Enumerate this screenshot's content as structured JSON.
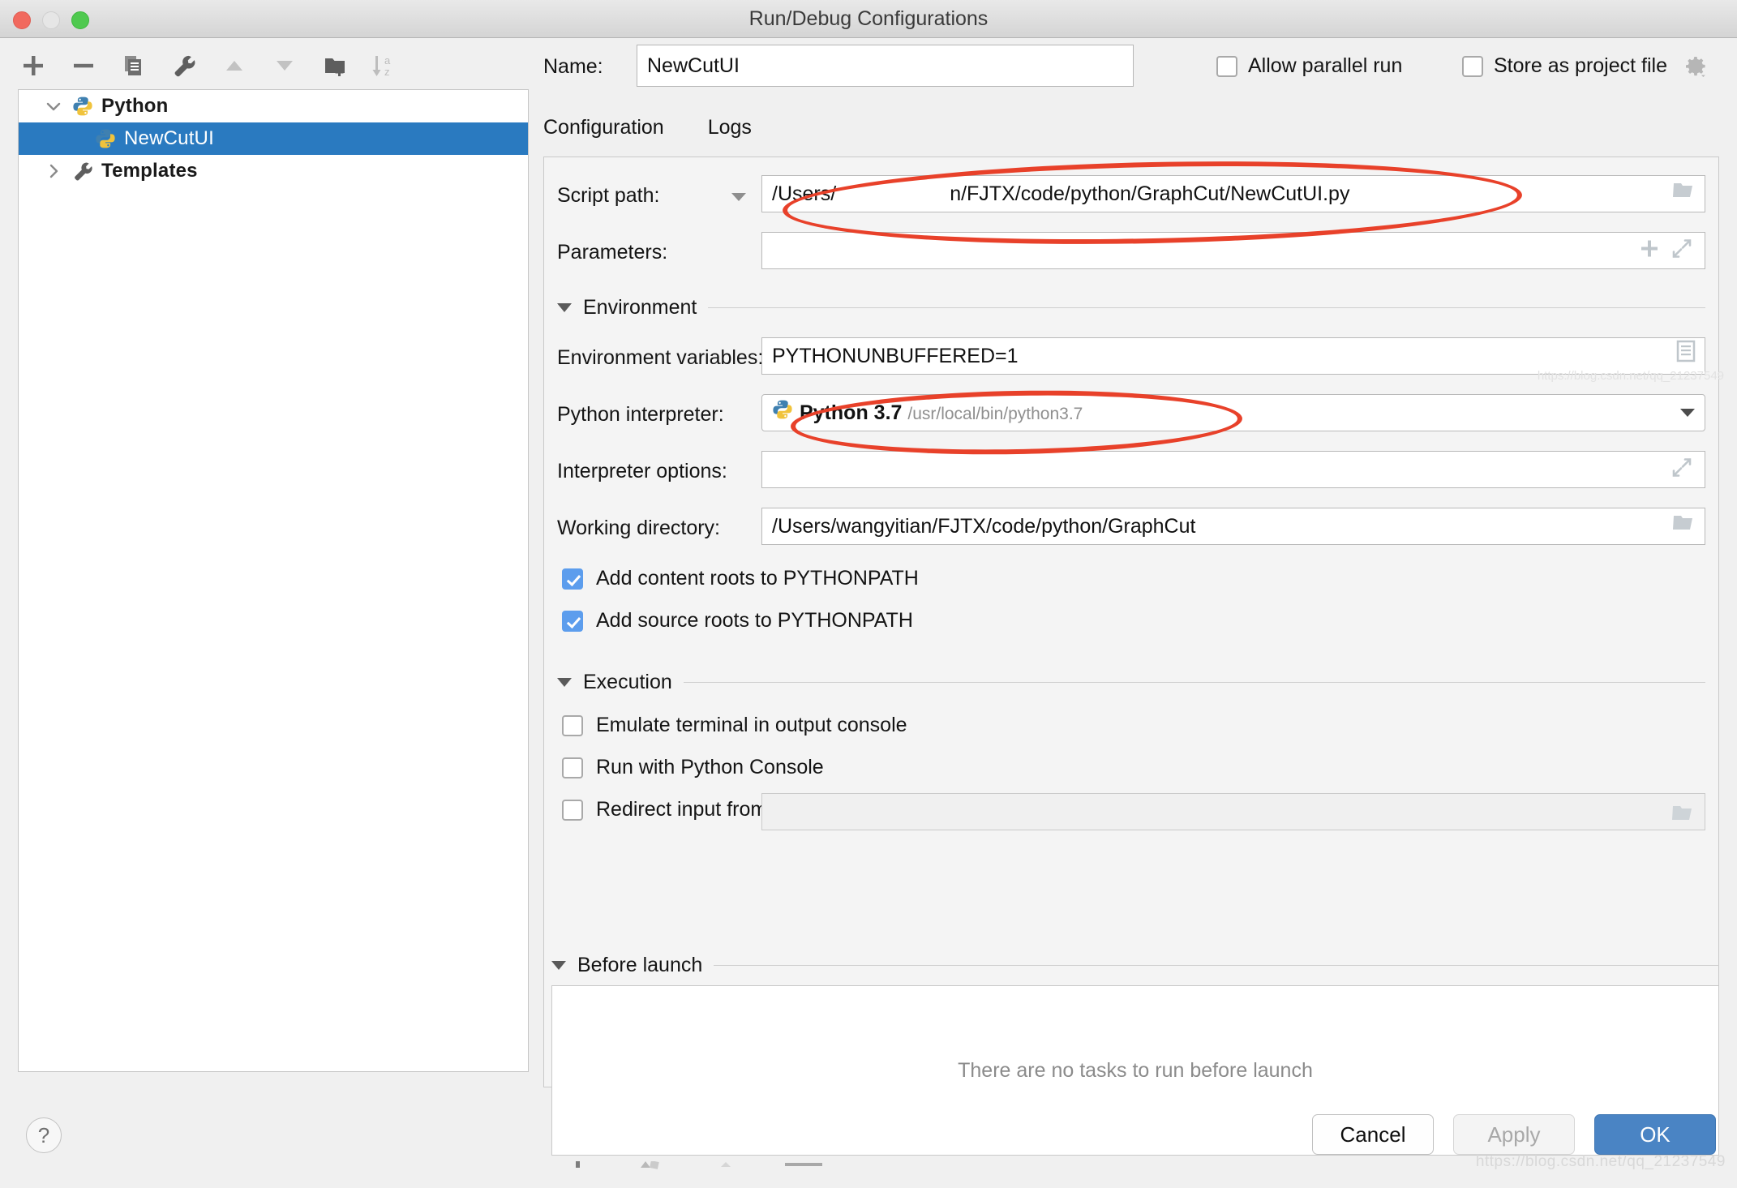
{
  "window": {
    "title": "Run/Debug Configurations",
    "traffic_lights": [
      "close",
      "minimize",
      "zoom"
    ]
  },
  "toolbar": {
    "buttons": [
      {
        "name": "add",
        "icon": "plus-icon"
      },
      {
        "name": "remove",
        "icon": "minus-icon"
      },
      {
        "name": "copy",
        "icon": "copy-icon"
      },
      {
        "name": "edit-templates",
        "icon": "wrench-icon"
      },
      {
        "name": "move-up",
        "icon": "arrow-up-icon"
      },
      {
        "name": "move-down",
        "icon": "arrow-down-icon"
      },
      {
        "name": "move-into-folder",
        "icon": "folder-add-icon"
      },
      {
        "name": "sort-alphabetically",
        "icon": "sort-az-icon"
      }
    ]
  },
  "tree": {
    "nodes": [
      {
        "label": "Python",
        "icon": "python-icon",
        "twisty": "chevron-down-icon",
        "expanded": true,
        "selected": false,
        "indent": false
      },
      {
        "label": "NewCutUI",
        "icon": "python-icon",
        "twisty": "",
        "expanded": false,
        "selected": true,
        "indent": true
      },
      {
        "label": "Templates",
        "icon": "wrench-icon",
        "twisty": "chevron-right-icon",
        "expanded": false,
        "selected": false,
        "indent": false
      }
    ]
  },
  "header": {
    "name_label": "Name:",
    "name_value": "NewCutUI",
    "allow_parallel_run": {
      "label": "Allow parallel run",
      "checked": false
    },
    "store_as_project_file": {
      "label": "Store as project file",
      "checked": false
    },
    "gear_icon": "gear-icon"
  },
  "tabs": [
    {
      "label": "Configuration",
      "active": true
    },
    {
      "label": "Logs",
      "active": false
    }
  ],
  "config": {
    "script_path": {
      "label": "Script path:",
      "value_prefix": "/Users/",
      "value_suffix": "n/FJTX/code/python/GraphCut/NewCutUI.py",
      "icon": "folder-icon",
      "dropdown_icon": "triangle-down-icon"
    },
    "parameters": {
      "label": "Parameters:",
      "value": "",
      "icons": [
        "plus-icon",
        "expand-icon"
      ]
    },
    "environment_section": {
      "title": "Environment",
      "expanded": true
    },
    "environment_variables": {
      "label": "Environment variables:",
      "value": "PYTHONUNBUFFERED=1",
      "icon": "list-icon"
    },
    "python_interpreter": {
      "label": "Python interpreter:",
      "icon": "python-icon",
      "value_name": "Python 3.7",
      "value_path": "/usr/local/bin/python3.7",
      "dropdown_icon": "triangle-down-icon"
    },
    "interpreter_options": {
      "label": "Interpreter options:",
      "value": "",
      "icon": "expand-icon"
    },
    "working_directory": {
      "label": "Working directory:",
      "value": "/Users/wangyitian/FJTX/code/python/GraphCut",
      "icon": "folder-icon"
    },
    "add_content_roots": {
      "label": "Add content roots to PYTHONPATH",
      "checked": true
    },
    "add_source_roots": {
      "label": "Add source roots to PYTHONPATH",
      "checked": true
    },
    "execution_section": {
      "title": "Execution",
      "expanded": true
    },
    "emulate_terminal": {
      "label": "Emulate terminal in output console",
      "checked": false
    },
    "run_with_python_console": {
      "label": "Run with Python Console",
      "checked": false
    },
    "redirect_input_from": {
      "label": "Redirect input from:",
      "checked": false,
      "value": "",
      "icon": "folder-icon"
    }
  },
  "before_launch": {
    "section_title": "Before launch",
    "expanded": true,
    "empty_text": "There are no tasks to run before launch",
    "footer_icons": [
      "add-task-icon",
      "remove-task-icon",
      "edit-task-icon",
      "move-up-icon",
      "move-down-icon"
    ]
  },
  "footer": {
    "help_label": "?",
    "cancel_label": "Cancel",
    "apply_label": "Apply",
    "apply_enabled": false,
    "ok_label": "OK"
  },
  "watermark": {
    "text": "https://blog.csdn.net/qq_21237549"
  },
  "colors": {
    "selection_blue": "#2a7ac0",
    "primary_button": "#4a84c4",
    "checkbox_checked": "#5c9ded",
    "annotation_red": "#e8412a",
    "window_bg": "#f0f0f0"
  }
}
